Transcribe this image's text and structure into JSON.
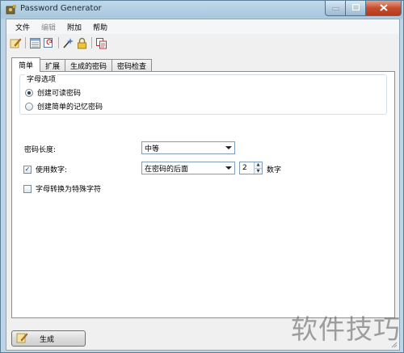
{
  "window": {
    "title": "Password Generator"
  },
  "menu": [
    {
      "label": "文件",
      "enabled": true
    },
    {
      "label": "编辑",
      "enabled": false
    },
    {
      "label": "附加",
      "enabled": true
    },
    {
      "label": "帮助",
      "enabled": true
    }
  ],
  "toolbar": [
    "pencil-icon",
    "list-icon",
    "refresh-icon",
    "wizard-icon",
    "lock-icon",
    "copy-icon"
  ],
  "tabs": [
    {
      "label": "简单",
      "active": true
    },
    {
      "label": "扩展",
      "active": false
    },
    {
      "label": "生成的密码",
      "active": false
    },
    {
      "label": "密码检查",
      "active": false
    }
  ],
  "char_options": {
    "title": "字母选项",
    "options": [
      {
        "label": "创建可读密码",
        "selected": true
      },
      {
        "label": "创建简单的记忆密码",
        "selected": false
      }
    ]
  },
  "length": {
    "label": "密码长度:",
    "value": "中等"
  },
  "digits": {
    "label": "使用数字:",
    "checked": true,
    "position": "在密码的后面",
    "count": "2",
    "unit": "数字"
  },
  "special": {
    "label": "字母转换为特殊字符",
    "checked": false
  },
  "generate": {
    "label": "生成"
  },
  "watermark": "软件技巧",
  "colors": {
    "close_button": "#c64d2c",
    "titlebar": "#a9c8dd"
  }
}
